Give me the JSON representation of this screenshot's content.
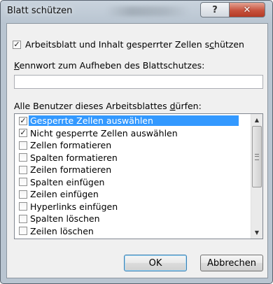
{
  "window": {
    "title": "Blatt schützen",
    "help_label": "?",
    "close_label": "✕"
  },
  "protect": {
    "checked": true,
    "label_before": "Arbeitsblatt und Inhalt gesperrter Zellen s",
    "label_underline": "c",
    "label_after": "hützen"
  },
  "password": {
    "label_underline": "K",
    "label_rest": "ennwort zum Aufheben des Blattschutzes:",
    "value": ""
  },
  "permissions": {
    "label_before": "Alle Benutzer dieses Arbeitsblattes ",
    "label_underline": "d",
    "label_after": "ürfen:",
    "items": [
      {
        "label": "Gesperrte Zellen auswählen",
        "checked": true,
        "selected": true
      },
      {
        "label": "Nicht gesperrte Zellen auswählen",
        "checked": true,
        "selected": false
      },
      {
        "label": "Zellen formatieren",
        "checked": false,
        "selected": false
      },
      {
        "label": "Spalten formatieren",
        "checked": false,
        "selected": false
      },
      {
        "label": "Zeilen formatieren",
        "checked": false,
        "selected": false
      },
      {
        "label": "Spalten einfügen",
        "checked": false,
        "selected": false
      },
      {
        "label": "Zeilen einfügen",
        "checked": false,
        "selected": false
      },
      {
        "label": "Hyperlinks einfügen",
        "checked": false,
        "selected": false
      },
      {
        "label": "Spalten löschen",
        "checked": false,
        "selected": false
      },
      {
        "label": "Zeilen löschen",
        "checked": false,
        "selected": false
      }
    ]
  },
  "buttons": {
    "ok": "OK",
    "cancel": "Abbrechen"
  },
  "colors": {
    "selection": "#3399ff",
    "close_button": "#c7523d"
  }
}
